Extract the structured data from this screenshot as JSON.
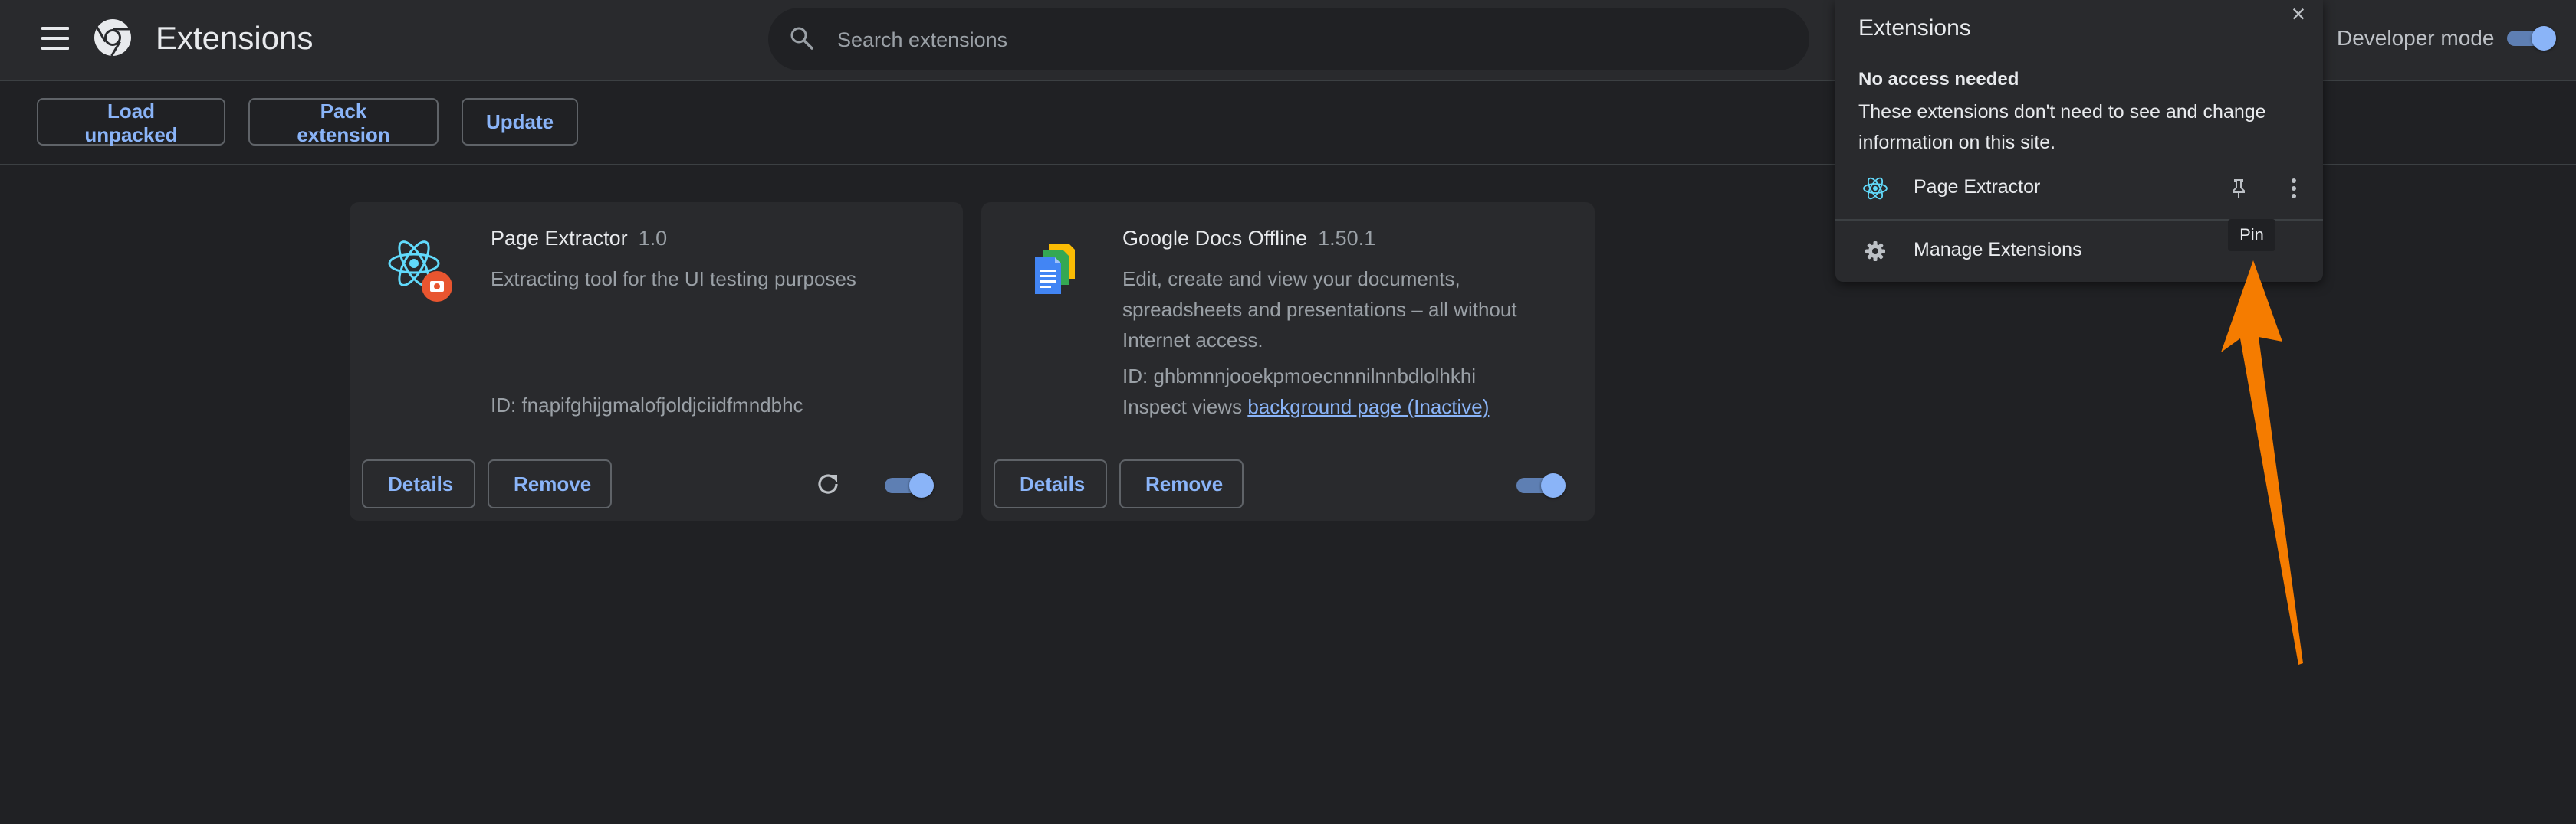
{
  "header": {
    "title": "Extensions",
    "search_placeholder": "Search extensions",
    "developer_mode_label": "Developer mode",
    "developer_mode_on": true
  },
  "toolbar": {
    "load_unpacked": "Load unpacked",
    "pack_extension": "Pack extension",
    "update": "Update"
  },
  "cards": [
    {
      "name": "Page Extractor",
      "version": "1.0",
      "description": "Extracting tool for the UI testing purposes",
      "id_line": "ID: fnapifghijgmalofjoldjciidfmndbhc",
      "details_label": "Details",
      "remove_label": "Remove",
      "enabled": true,
      "icon": "react-atom-icon"
    },
    {
      "name": "Google Docs Offline",
      "version": "1.50.1",
      "description": "Edit, create and view your documents, spreadsheets and presentations – all without Internet access.",
      "id_line": "ID: ghbmnnjooekpmoecnnnilnnbdlolhkhi",
      "inspect_prefix": "Inspect views",
      "inspect_link": "background page (Inactive)",
      "details_label": "Details",
      "remove_label": "Remove",
      "enabled": true,
      "icon": "google-docs-icon"
    }
  ],
  "popup": {
    "title": "Extensions",
    "section_heading": "No access needed",
    "section_desc": "These extensions don't need to see and change information on this site.",
    "extension_item": "Page Extractor",
    "manage_label": "Manage Extensions",
    "pin_tooltip": "Pin"
  },
  "colors": {
    "background": "#202124",
    "surface": "#292a2d",
    "accent": "#8ab4f8",
    "annotation_arrow": "#f57c00"
  }
}
